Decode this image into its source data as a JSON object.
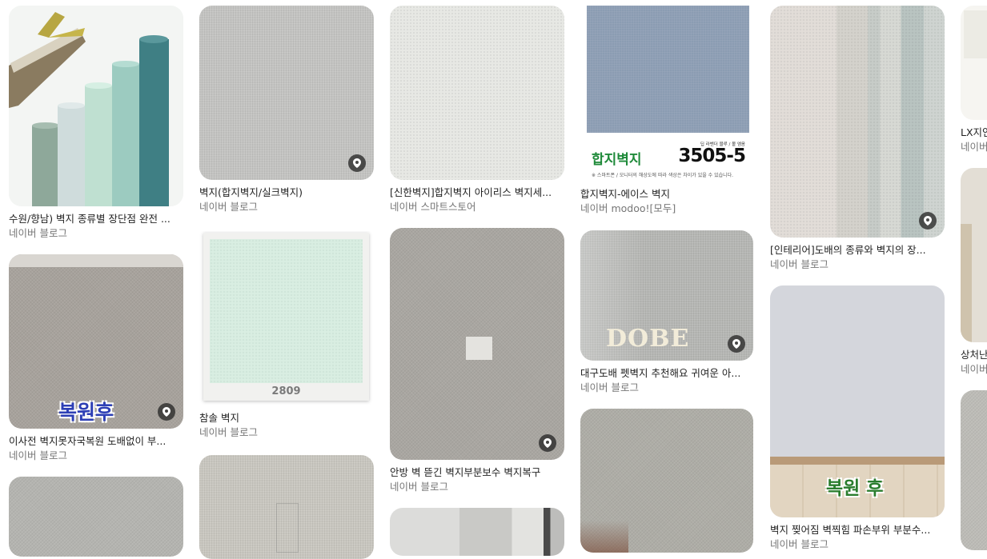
{
  "results": [
    {
      "title": "수원/향남) 벽지 종류별 장단점 완전 ...",
      "source": "네이버 블로그"
    },
    {
      "title": "벽지(합지벽지/실크벽지)",
      "source": "네이버 블로그"
    },
    {
      "title": "[신한벽지]합지벽지 아이리스 벽지세...",
      "source": "네이버 스마트스토어"
    },
    {
      "title": "합지벽지-에이스 벽지",
      "source": "네이버 modoo![모두]"
    },
    {
      "title": "[인테리어]도배의 종류와 벽지의 장...",
      "source": "네이버 블로그"
    },
    {
      "title": "LX지인...",
      "source": "네이버..."
    },
    {
      "title": "이사전 벽지못자국복원 도배없이 부...",
      "source": "네이버 블로그"
    },
    {
      "title": "참솔 벽지",
      "source": "네이버 블로그"
    },
    {
      "title": "안방 벽 뜯긴 벽지부분보수 벽지복구",
      "source": "네이버 블로그"
    },
    {
      "title": "대구도배 펫벽지 추천해요 귀여운 아...",
      "source": "네이버 블로그"
    },
    {
      "title": "벽지 찢어짐 벽찍힘 파손부위 부분수...",
      "source": "네이버 블로그"
    },
    {
      "title": "상처난...",
      "source": "네이버..."
    }
  ],
  "overlays": {
    "hapji_brand": "합지벽지",
    "hapji_code": "3505-5",
    "hapji_small_top": "딥 라벤더 블루 / 볼 엠옴",
    "hapji_note": "※ 스마트폰 / 모니터의 해상도에 따라 색상은 차이가 있을 수 있습니다.",
    "chamsol_code": "2809",
    "dobe_logo": "DOBE",
    "restored_1": "복원후",
    "restored_2": "복원 후"
  },
  "colors": {
    "title_text": "#222222",
    "source_text": "#767676",
    "hapji_brand": "#1f8a3a",
    "restored_blue": "#2d3fb5",
    "restored_green": "#2a7d2e"
  }
}
